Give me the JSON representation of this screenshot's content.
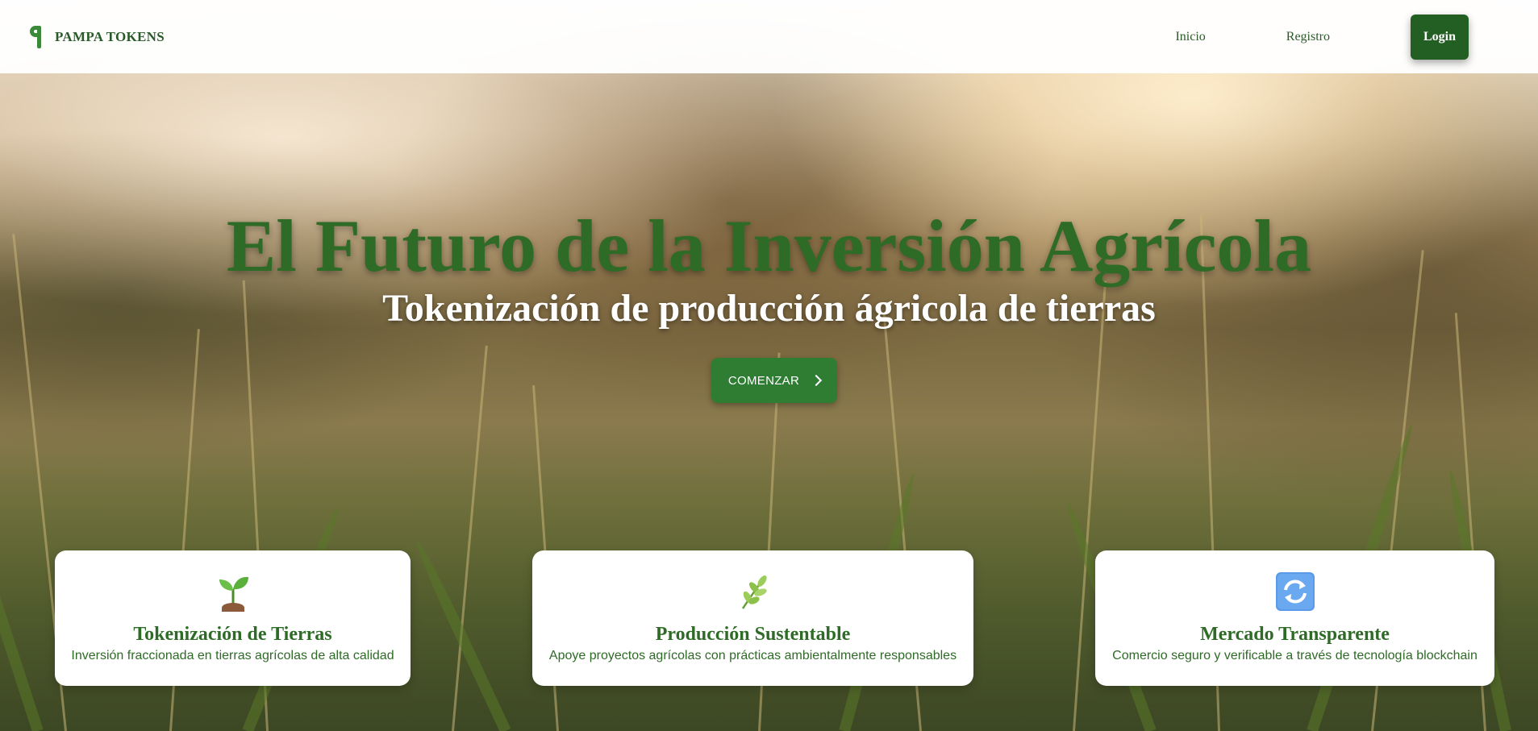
{
  "header": {
    "brand_name": "PAMPA TOKENS",
    "nav": {
      "inicio": "Inicio",
      "registro": "Registro",
      "login": "Login"
    }
  },
  "hero": {
    "title": "El Futuro de la Inversión Agrícola",
    "subtitle": "Tokenización de producción ágricola de tierras",
    "cta_label": "COMENZAR",
    "cta_icon": "chevron-right-icon"
  },
  "features": [
    {
      "icon": "seedling-icon",
      "title": "Tokenización de Tierras",
      "description": "Inversión fraccionada en tierras agrícolas de alta calidad"
    },
    {
      "icon": "herb-icon",
      "title": "Producción Sustentable",
      "description": "Apoye proyectos agrícolas con prácticas ambientalmente responsables"
    },
    {
      "icon": "refresh-arrows-icon",
      "title": "Mercado Transparente",
      "description": "Comercio seguro y verificable a través de tecnología blockchain"
    }
  ],
  "colors": {
    "brand_green": "#2e6b26",
    "button_green": "#2e7d32",
    "login_green": "#235e23",
    "header_bg": "#ffffff"
  }
}
